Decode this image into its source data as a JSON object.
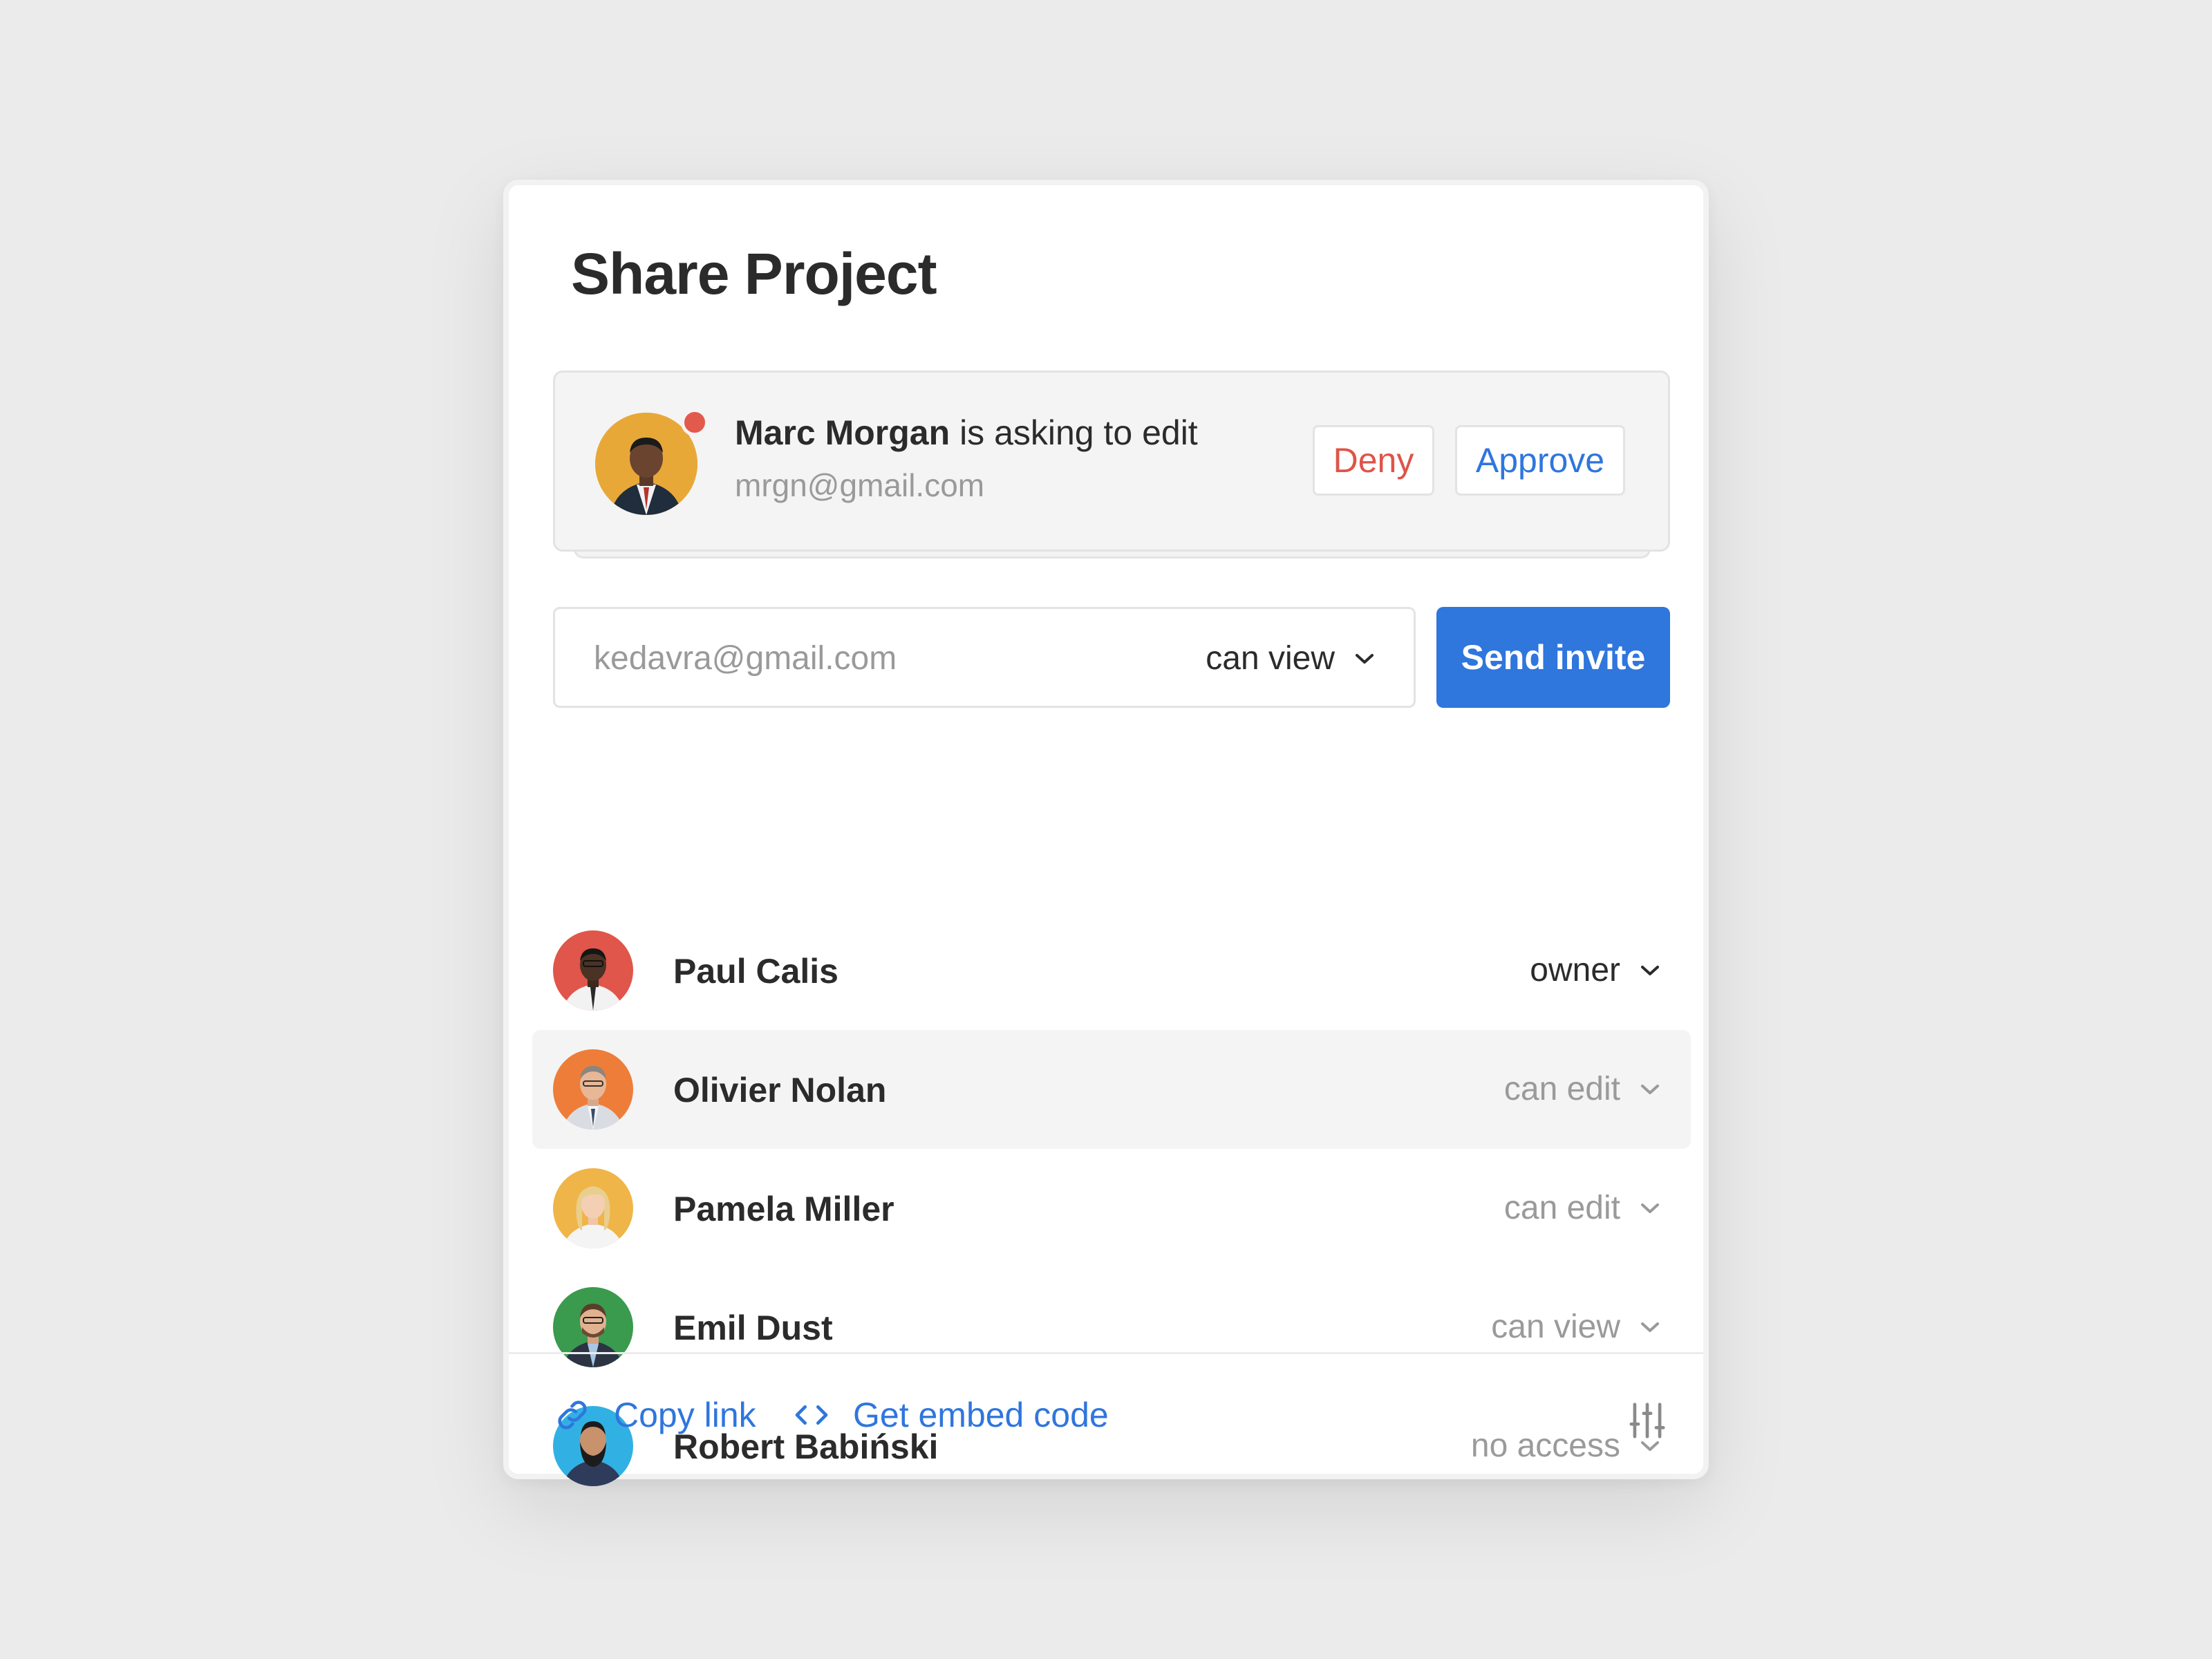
{
  "dialog": {
    "title": "Share Project"
  },
  "request": {
    "name": "Marc Morgan",
    "message": " is asking to edit",
    "email": "mrgn@gmail.com",
    "deny_label": "Deny",
    "approve_label": "Approve",
    "avatar_color": "#e8a838",
    "dot_color": "#e25a4c"
  },
  "invite": {
    "email_value": "kedavra@gmail.com",
    "permission": "can view",
    "send_label": "Send invite"
  },
  "members": [
    {
      "name": "Paul Calis",
      "permission": "owner",
      "avatar_color": "#e0564a"
    },
    {
      "name": "Olivier Nolan",
      "permission": "can edit",
      "avatar_color": "#ee7d3a"
    },
    {
      "name": "Pamela Miller",
      "permission": "can edit",
      "avatar_color": "#f0b548"
    },
    {
      "name": "Emil Dust",
      "permission": "can view",
      "avatar_color": "#3a9a4e"
    },
    {
      "name": "Robert Babiński",
      "permission": "no access",
      "avatar_color": "#31b1e3"
    }
  ],
  "footer": {
    "copy_link_label": "Copy link",
    "embed_label": "Get embed code"
  },
  "colors": {
    "accent": "#2f76dd",
    "deny": "#df5448"
  },
  "icons": [
    "link-icon",
    "code-icon",
    "sliders-icon",
    "chevron-down-icon"
  ]
}
